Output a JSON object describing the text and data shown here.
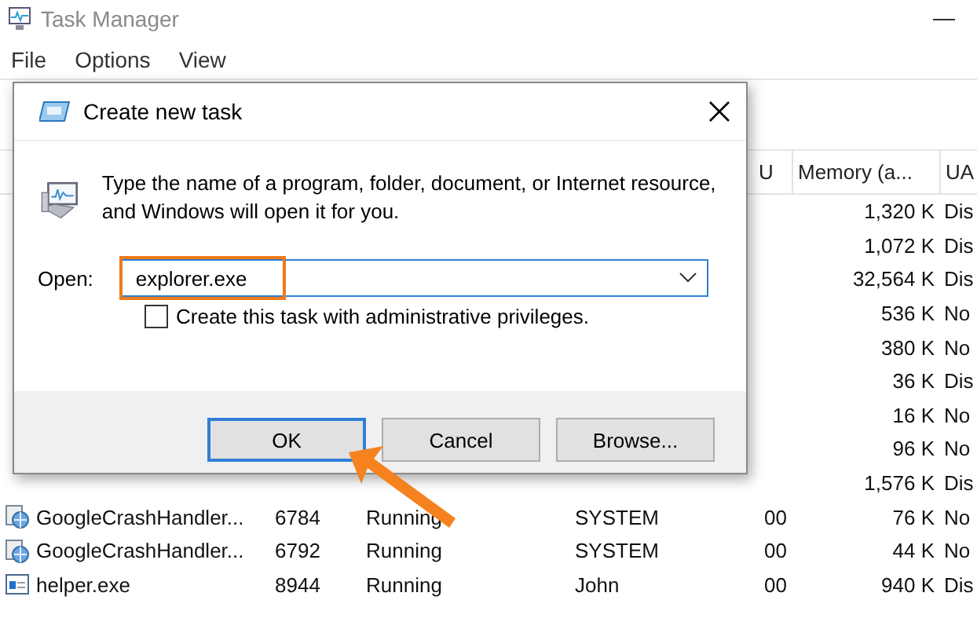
{
  "window": {
    "title": "Task Manager"
  },
  "menu": [
    "File",
    "Options",
    "View"
  ],
  "table": {
    "columns": [
      {
        "label": "U"
      },
      {
        "label": "Memory (a..."
      },
      {
        "label": "UA"
      }
    ],
    "rows": [
      {
        "memory": "1,320 K",
        "uac": "Dis"
      },
      {
        "memory": "1,072 K",
        "uac": "Dis"
      },
      {
        "memory": "32,564 K",
        "uac": "Dis"
      },
      {
        "memory": "536 K",
        "uac": "No"
      },
      {
        "memory": "380 K",
        "uac": "No"
      },
      {
        "memory": "36 K",
        "uac": "Dis"
      },
      {
        "memory": "16 K",
        "uac": "No"
      },
      {
        "memory": "96 K",
        "uac": "No"
      },
      {
        "memory": "1,576 K",
        "uac": "Dis"
      },
      {
        "kind": "service",
        "name": "GoogleCrashHandler...",
        "pid": "6784",
        "status": "Running",
        "user": "SYSTEM",
        "cpu": "00",
        "memory": "76 K",
        "uac": "No"
      },
      {
        "kind": "service",
        "name": "GoogleCrashHandler...",
        "pid": "6792",
        "status": "Running",
        "user": "SYSTEM",
        "cpu": "00",
        "memory": "44 K",
        "uac": "No"
      },
      {
        "kind": "app",
        "name": "helper.exe",
        "pid": "8944",
        "status": "Running",
        "user": "John",
        "cpu": "00",
        "memory": "940 K",
        "uac": "Dis"
      }
    ]
  },
  "dialog": {
    "title": "Create new task",
    "description": "Type the name of a program, folder, document, or Internet resource, and Windows will open it for you.",
    "open_label": "Open:",
    "open_value": "explorer.exe",
    "checkbox": {
      "label": "Create this task with administrative privileges.",
      "checked": false
    },
    "buttons": [
      {
        "label": "OK",
        "default": true
      },
      {
        "label": "Cancel",
        "default": false
      },
      {
        "label": "Browse...",
        "default": false
      }
    ]
  }
}
